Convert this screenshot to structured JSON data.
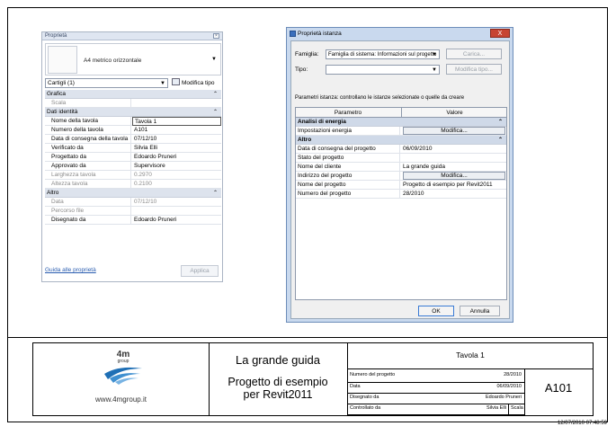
{
  "sheet": {
    "timestamp": "12/07/2010 07:48:59"
  },
  "properties_panel": {
    "title": "Proprietà",
    "close_glyph": "×",
    "type_name": "A4 metrico orizzontale",
    "selector": "Cartigli (1)",
    "edit_type_label": "Modifica tipo",
    "groups": [
      {
        "name": "Grafica",
        "rows": [
          {
            "key": "Scala",
            "value": "",
            "dim": true
          }
        ]
      },
      {
        "name": "Dati identità",
        "rows": [
          {
            "key": "Nome della tavola",
            "value": "Tavola 1",
            "active": true
          },
          {
            "key": "Numero della tavola",
            "value": "A101"
          },
          {
            "key": "Data di consegna della tavola",
            "value": "07/12/10"
          },
          {
            "key": "Verificato da",
            "value": "Silvia Elli"
          },
          {
            "key": "Progettato da",
            "value": "Edoardo Pruneri"
          },
          {
            "key": "Approvato da",
            "value": "Supervisore"
          },
          {
            "key": "Larghezza tavola",
            "value": "0.2970",
            "dim": true
          },
          {
            "key": "Altezza tavola",
            "value": "0.2100",
            "dim": true
          }
        ]
      },
      {
        "name": "Altro",
        "rows": [
          {
            "key": "Data",
            "value": "07/12/10",
            "dim": true
          },
          {
            "key": "Percorso file",
            "value": "",
            "dim": true
          },
          {
            "key": "Disegnato da",
            "value": "Edoardo Pruneri"
          }
        ]
      }
    ],
    "help_link": "Guida alle proprietà",
    "apply_label": "Applica"
  },
  "dialog": {
    "title": "Proprietà istanza",
    "close_glyph": "X",
    "family_label": "Famiglia:",
    "family_value": "Famiglia di sistema: Informazioni sul progetto",
    "load_label": "Carica...",
    "type_label": "Tipo:",
    "type_value": "",
    "edit_type_label": "Modifica tipo...",
    "description": "Parametri istanza: controllano le istanze selezionate o quelle da creare",
    "col_param": "Parametro",
    "col_value": "Valore",
    "groups": [
      {
        "name": "Analisi di energia",
        "rows": [
          {
            "key": "Impostazioni energia",
            "value": "Modifica...",
            "button": true
          }
        ]
      },
      {
        "name": "Altro",
        "rows": [
          {
            "key": "Data di consegna del progetto",
            "value": "06/09/2010"
          },
          {
            "key": "Stato del progetto",
            "value": ""
          },
          {
            "key": "Nome del cliente",
            "value": "La grande guida"
          },
          {
            "key": "Indirizzo del progetto",
            "value": "Modifica...",
            "button": true
          },
          {
            "key": "Nome del progetto",
            "value": "Progetto di esempio per Revit2011"
          },
          {
            "key": "Numero del progetto",
            "value": "28/2010"
          }
        ]
      }
    ],
    "ok_label": "OK",
    "cancel_label": "Annulla"
  },
  "title_block": {
    "logo_text": "4m",
    "logo_sub": "group",
    "website": "www.4mgroup.it",
    "client": "La grande guida",
    "project_line1": "Progetto di esempio",
    "project_line2": "per Revit2011",
    "sheet_name": "Tavola 1",
    "meta": [
      {
        "key": "Numero del progetto",
        "value": "28/2010"
      },
      {
        "key": "Data",
        "value": "06/09/2010"
      },
      {
        "key": "Disegnato da",
        "value": "Edoardo Pruneri"
      },
      {
        "key": "Controllato da",
        "value": "Silvia Elli",
        "extra": "Scala"
      }
    ],
    "sheet_number": "A101",
    "colors": {
      "logo_blue": "#1f6fb5"
    }
  }
}
